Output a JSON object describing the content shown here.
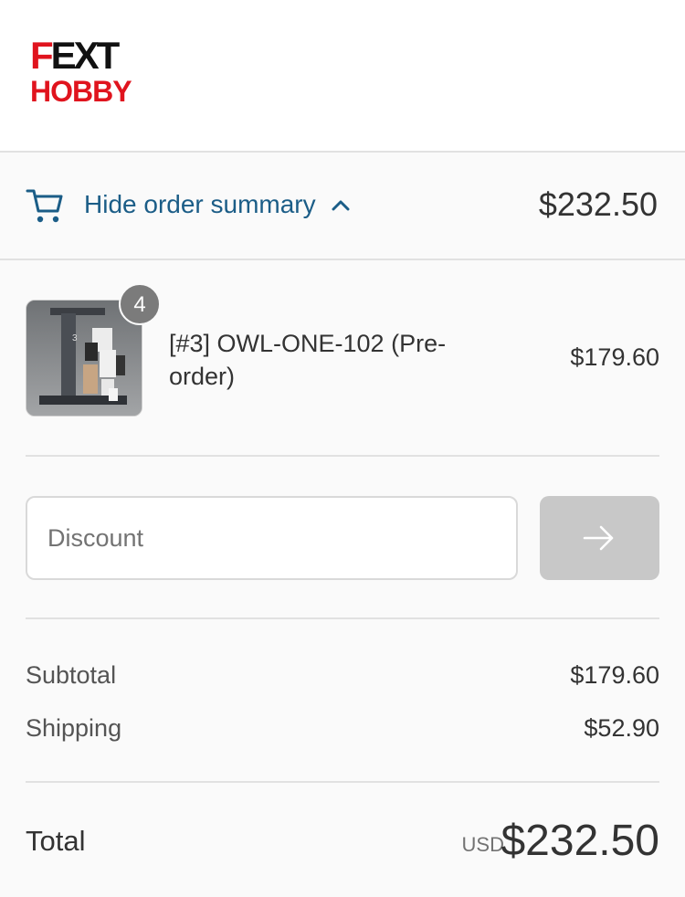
{
  "brand": {
    "logo_line1": "FEXT",
    "logo_line2": "HOBBY"
  },
  "summary_bar": {
    "toggle_label": "Hide order summary",
    "total": "$232.50",
    "icons": {
      "cart": "cart-icon",
      "chevron": "chevron-up-icon"
    }
  },
  "items": [
    {
      "quantity": "4",
      "name": "[#3] OWL-ONE-102 (Pre-order)",
      "price": "$179.60",
      "thumbnail": "product-figure-on-stand"
    }
  ],
  "discount": {
    "placeholder": "Discount",
    "apply_icon": "arrow-right-icon"
  },
  "totals": {
    "subtotal_label": "Subtotal",
    "subtotal": "$179.60",
    "shipping_label": "Shipping",
    "shipping": "$52.90",
    "total_label": "Total",
    "currency": "USD",
    "total": "$232.50"
  },
  "colors": {
    "link": "#1b5d87",
    "brand_red": "#e0141e",
    "button_disabled": "#c8c8c8"
  }
}
